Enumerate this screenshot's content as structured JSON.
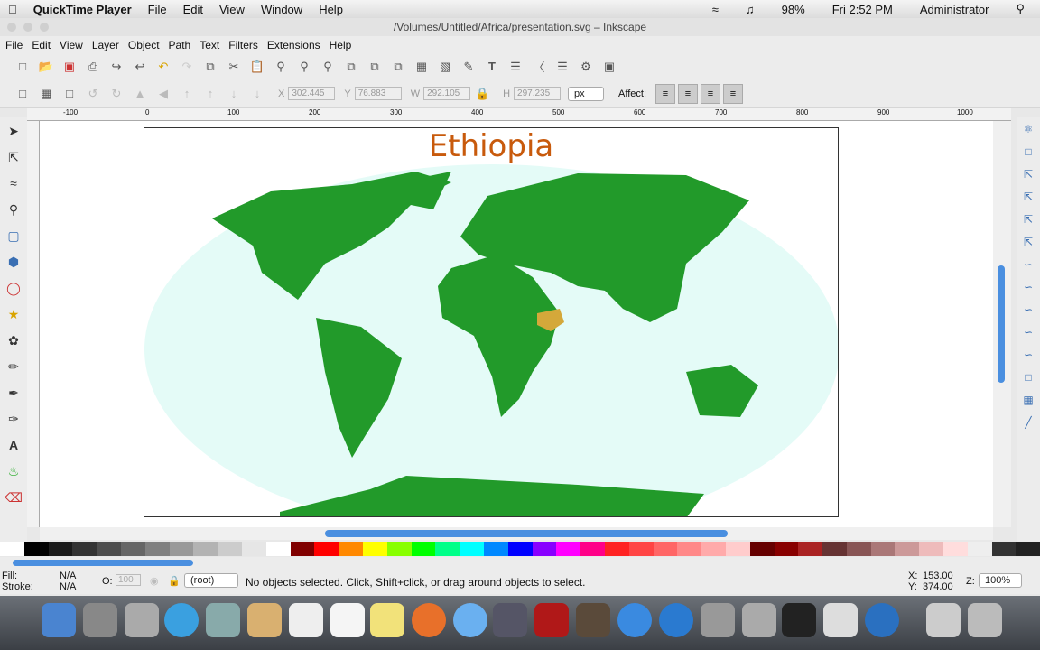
{
  "mac_menu": {
    "app": "QuickTime Player",
    "items": [
      "File",
      "Edit",
      "View",
      "Window",
      "Help"
    ],
    "battery": "98%",
    "clock": "Fri 2:52 PM",
    "user": "Administrator"
  },
  "window": {
    "title": "/Volumes/Untitled/Africa/presentation.svg – Inkscape"
  },
  "menu": [
    "File",
    "Edit",
    "View",
    "Layer",
    "Object",
    "Path",
    "Text",
    "Filters",
    "Extensions",
    "Help"
  ],
  "toolcontrols": {
    "x_label": "X",
    "x": "302.445",
    "y_label": "Y",
    "y": "76.883",
    "w_label": "W",
    "w": "292.105",
    "h_label": "H",
    "h": "297.235",
    "unit": "px",
    "affect": "Affect:"
  },
  "ruler": [
    "-100",
    "0",
    "100",
    "200",
    "300",
    "400",
    "500",
    "600",
    "700",
    "800",
    "900",
    "1000"
  ],
  "document": {
    "title": "Ethiopia"
  },
  "status": {
    "fill_label": "Fill:",
    "fill": "N/A",
    "stroke_label": "Stroke:",
    "stroke": "N/A",
    "opacity_label": "O:",
    "opacity": "100",
    "layer": "(root)",
    "message": "No objects selected. Click, Shift+click, or drag around objects to select.",
    "x_label": "X:",
    "x": "153.00",
    "y_label": "Y:",
    "y": "374.00",
    "zoom_label": "Z:",
    "zoom": "100%"
  },
  "colors": {
    "land": "#229a2a",
    "ocean": "#e4fbf7",
    "highlight": "#d4a83a",
    "title": "#c85a0c",
    "accent": "#4a8fe0"
  }
}
